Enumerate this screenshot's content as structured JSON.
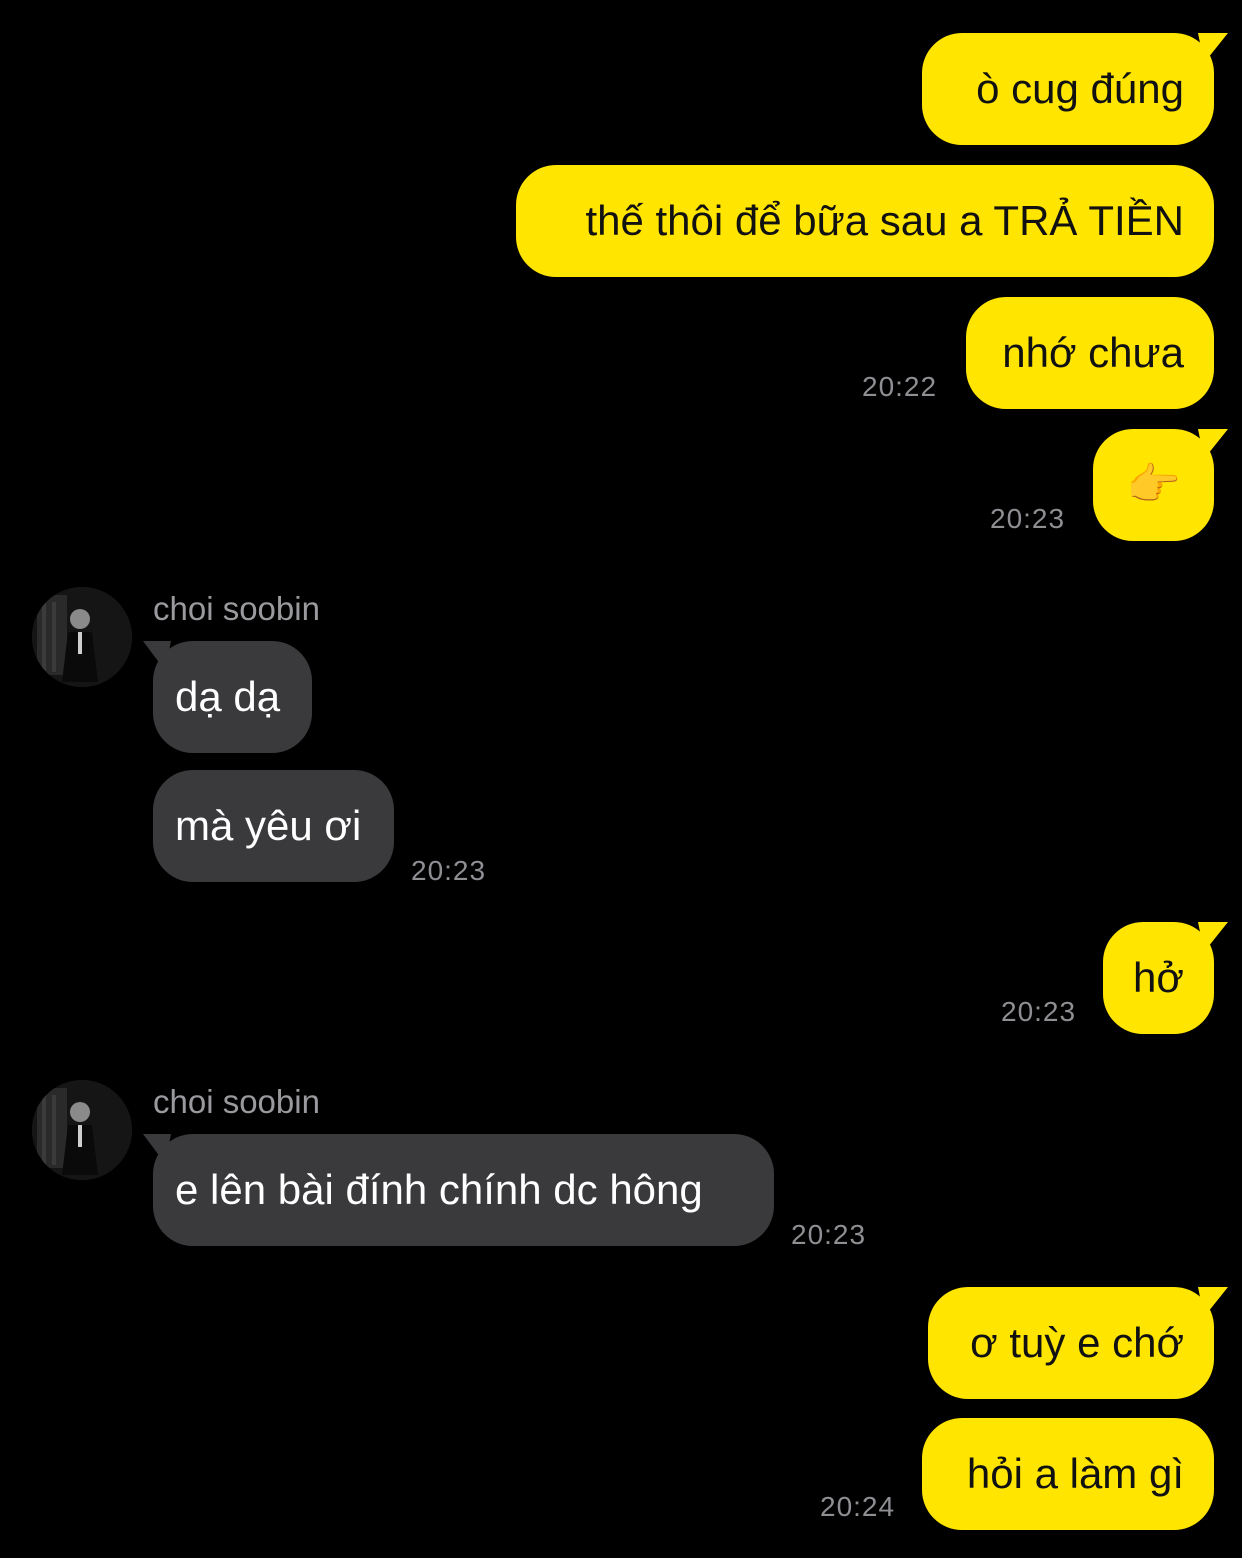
{
  "contact": {
    "name": "choi soobin"
  },
  "messages": [
    {
      "id": "m1",
      "side": "outgoing",
      "text": "ò cug đúng"
    },
    {
      "id": "m2",
      "side": "outgoing",
      "text": "thế thôi để bữa sau a TRẢ TIỀN"
    },
    {
      "id": "m3",
      "side": "outgoing",
      "text": "nhớ chưa",
      "time": "20:22"
    },
    {
      "id": "m4",
      "side": "outgoing",
      "text": "👉",
      "icon": "pointing-finger-emoji",
      "time": "20:23"
    },
    {
      "id": "m5",
      "side": "incoming",
      "sender": "choi soobin",
      "text": "dạ dạ"
    },
    {
      "id": "m6",
      "side": "incoming",
      "text": "mà yêu ơi",
      "time": "20:23"
    },
    {
      "id": "m7",
      "side": "outgoing",
      "text": "hở",
      "time": "20:23"
    },
    {
      "id": "m8",
      "side": "incoming",
      "sender": "choi soobin",
      "text": "e lên bài đính chính dc hông",
      "time": "20:23"
    },
    {
      "id": "m9",
      "side": "outgoing",
      "text": "ơ tuỳ e chớ"
    },
    {
      "id": "m10",
      "side": "outgoing",
      "text": "hỏi a làm gì",
      "time": "20:24"
    }
  ],
  "colors": {
    "background": "#000000",
    "outgoing_bubble": "#FFE500",
    "incoming_bubble": "#3A3A3C",
    "timestamp": "#8E8E93"
  }
}
